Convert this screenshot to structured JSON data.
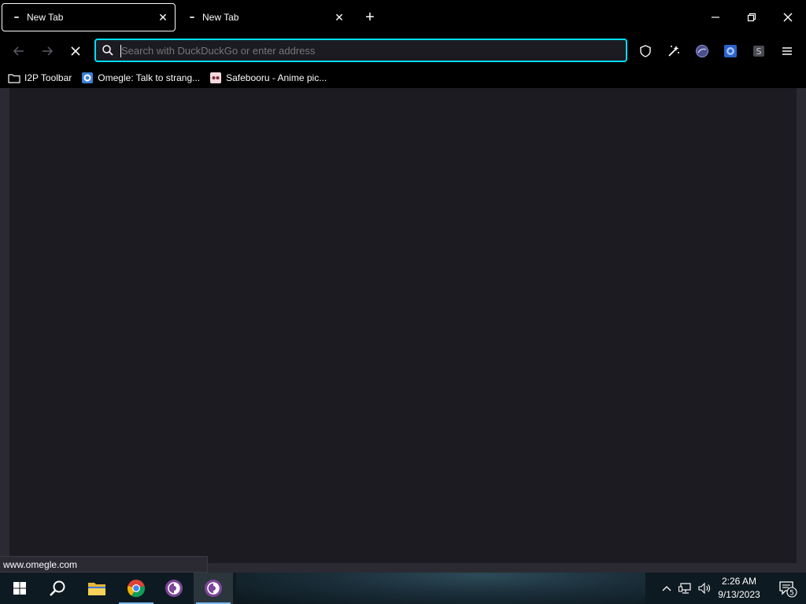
{
  "browser": {
    "tabs": [
      {
        "label": "New Tab",
        "active": true
      },
      {
        "label": "New Tab",
        "active": false
      }
    ],
    "new_tab_symbol": "+",
    "window_controls": {
      "minimize": "minimize-icon",
      "restore": "restore-icon",
      "close": "close-icon"
    }
  },
  "navbar": {
    "back_icon": "back-arrow-icon",
    "forward_icon": "forward-arrow-icon",
    "stop_icon": "stop-loading-icon",
    "urlbar": {
      "placeholder": "Search with DuckDuckGo or enter address",
      "value": ""
    },
    "extensions": [
      "shield-icon",
      "magic-wand-icon",
      "extension-globe-icon",
      "extension-blue-icon",
      "extension-s-icon"
    ],
    "menu_icon": "hamburger-menu-icon"
  },
  "bookmarks": [
    {
      "label": "I2P Toolbar",
      "icon": "folder-icon"
    },
    {
      "label": "Omegle: Talk to strang...",
      "icon": "omegle-icon"
    },
    {
      "label": "Safebooru - Anime pic...",
      "icon": "safebooru-icon"
    }
  ],
  "status": {
    "url": "www.omegle.com"
  },
  "taskbar": {
    "apps": [
      "windows-start-icon",
      "search-icon",
      "file-explorer-icon",
      "chrome-icon",
      "tor-browser-icon",
      "tor-browser-icon"
    ],
    "clock": {
      "time": "2:26 AM",
      "date": "9/13/2023"
    },
    "notification_count": "5"
  },
  "colors": {
    "accent": "#00ddff",
    "background": "#1c1b22",
    "chrome": "#000000"
  }
}
